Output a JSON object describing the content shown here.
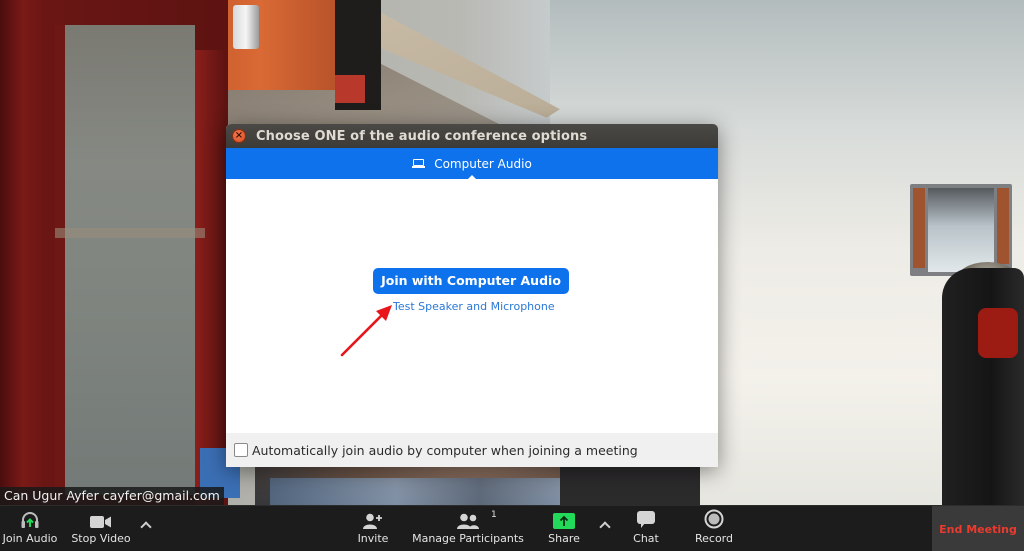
{
  "video": {
    "participant_label": "Can Ugur Ayfer cayfer@gmail.com"
  },
  "dialog": {
    "title": "Choose ONE of the audio conference options",
    "close_icon": "close-icon",
    "tab": {
      "label": "Computer Audio",
      "icon": "laptop-icon"
    },
    "join_button_label": "Join with Computer Audio",
    "test_link_label": "Test Speaker and Microphone",
    "auto_join_checkbox": {
      "label": "Automatically join audio by computer when joining a meeting",
      "checked": false
    },
    "annotation_arrow_color": "#e8161b"
  },
  "toolbar": {
    "items": [
      {
        "label": "Join Audio",
        "icon": "headphones-icon"
      },
      {
        "label": "Stop Video",
        "icon": "video-camera-icon"
      },
      {
        "label": "Invite",
        "icon": "add-user-icon"
      },
      {
        "label": "Manage Participants",
        "icon": "participants-icon",
        "count": "1"
      },
      {
        "label": "Share",
        "icon": "share-screen-icon"
      },
      {
        "label": "Chat",
        "icon": "chat-icon"
      },
      {
        "label": "Record",
        "icon": "record-icon"
      }
    ],
    "end_meeting_label": "End Meeting",
    "colors": {
      "share_green": "#23d959",
      "end_meeting_red": "#ea3b2e",
      "accent_blue": "#0e72ed"
    }
  }
}
